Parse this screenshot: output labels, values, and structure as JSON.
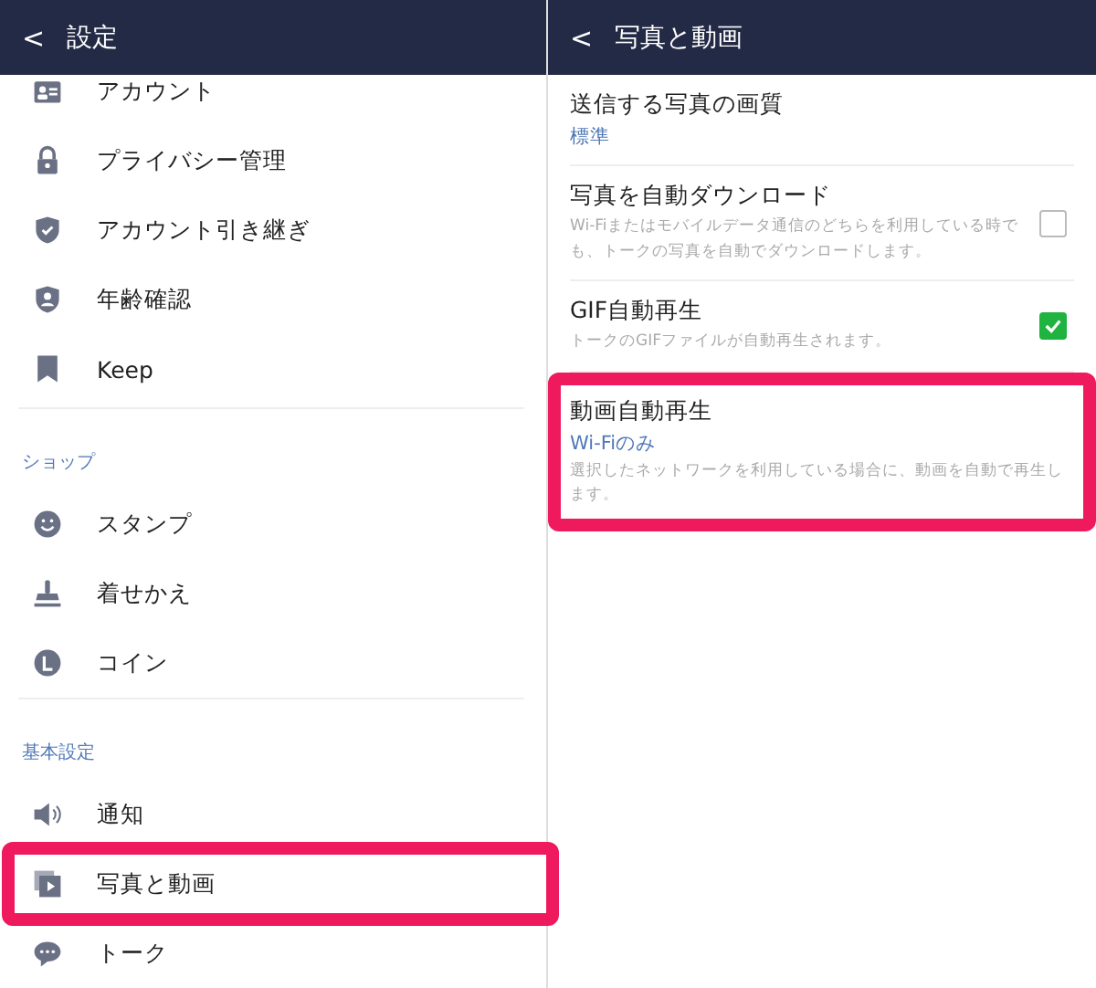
{
  "left_panel": {
    "header": {
      "back": "<",
      "title": "設定"
    },
    "sections": [
      {
        "items": [
          {
            "label": "アカウント",
            "highlighted": false
          },
          {
            "label": "プライバシー管理",
            "highlighted": false
          },
          {
            "label": "アカウント引き継ぎ",
            "highlighted": false
          },
          {
            "label": "年齢確認",
            "highlighted": false
          },
          {
            "label": "Keep",
            "highlighted": false
          }
        ]
      },
      {
        "title": "ショップ",
        "items": [
          {
            "label": "スタンプ",
            "highlighted": false
          },
          {
            "label": "着せかえ",
            "highlighted": false
          },
          {
            "label": "コイン",
            "highlighted": false
          }
        ]
      },
      {
        "title": "基本設定",
        "items": [
          {
            "label": "通知",
            "highlighted": false
          },
          {
            "label": "写真と動画",
            "highlighted": true
          },
          {
            "label": "トーク",
            "highlighted": false
          }
        ]
      }
    ]
  },
  "right_panel": {
    "header": {
      "back": "<",
      "title": "写真と動画"
    },
    "settings": [
      {
        "kind": "value",
        "title": "送信する写真の画質",
        "value": "標準",
        "highlighted": false
      },
      {
        "kind": "checkbox",
        "title": "写真を自動ダウンロード",
        "description": "Wi-Fiまたはモバイルデータ通信のどちらを利用している時でも、トークの写真を自動でダウンロードします。",
        "checked": false,
        "highlighted": false
      },
      {
        "kind": "checkbox",
        "title": "GIF自動再生",
        "description": "トークのGIFファイルが自動再生されます。",
        "checked": true,
        "highlighted": false
      },
      {
        "kind": "value",
        "title": "動画自動再生",
        "value": "Wi-Fiのみ",
        "description": "選択したネットワークを利用している場合に、動画を自動で再生します。",
        "highlighted": true
      }
    ]
  }
}
